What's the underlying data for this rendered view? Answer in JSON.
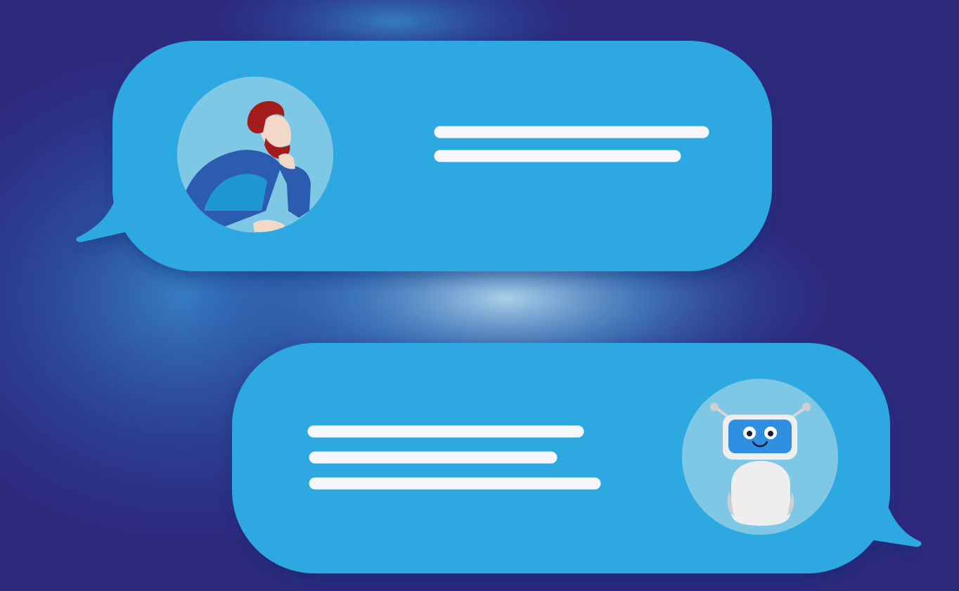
{
  "colors": {
    "background_deep": "#2e2a7e",
    "background_mid": "#1b4ea6",
    "glow": "#7fc3e8",
    "bubble": "#2fa8e0",
    "bubble_shadow": "#1f5fa8",
    "text_line": "#f5f7fa",
    "avatar_circle": "#7ec8e6",
    "hair": "#a41b1b",
    "skin": "#f2d8c8",
    "shirt": "#1f98d1",
    "sleeve": "#2b5cb0",
    "robot_body": "#eeeeee",
    "robot_screen": "#2f8fe0"
  },
  "messages": [
    {
      "sender": "user",
      "avatar": "person-thinking-icon",
      "text_lines": 2
    },
    {
      "sender": "bot",
      "avatar": "robot-icon",
      "text_lines": 3
    }
  ]
}
